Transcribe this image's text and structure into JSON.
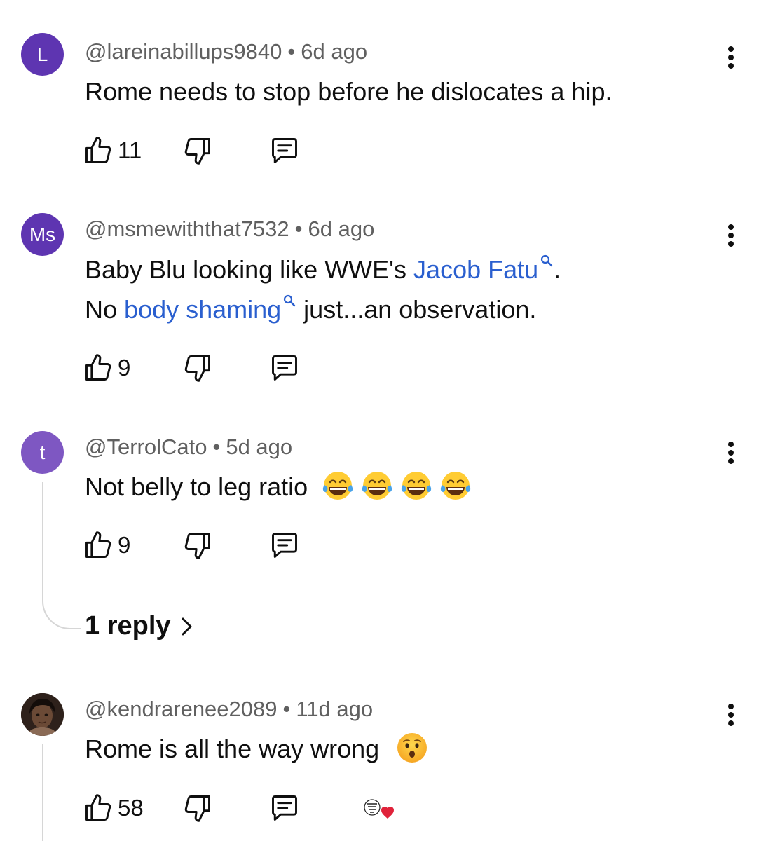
{
  "comments": [
    {
      "avatar_letter": "L",
      "avatar_color": "#5e35b1",
      "username": "@lareinabillups9840",
      "time": "6d ago",
      "text": "Rome needs to stop before he dislocates a hip.",
      "likes": "11"
    },
    {
      "avatar_letter": "Ms",
      "avatar_color": "#5e35b1",
      "username": "@msmewiththat7532",
      "time": "6d ago",
      "text_parts": {
        "line1_a": "Baby Blu looking like WWE's ",
        "line1_link": "Jacob Fatu",
        "line1_b": ".",
        "line2_a": "No ",
        "line2_link": "body shaming",
        "line2_b": " just...an observation."
      },
      "likes": "9"
    },
    {
      "avatar_letter": "t",
      "avatar_color": "#7e57c2",
      "username": "@TerrolCato",
      "time": "5d ago",
      "text": "Not belly to leg ratio",
      "emoji_count": 4,
      "emoji_name": "face-with-tears-of-joy",
      "likes": "9",
      "replies_label": "1 reply"
    },
    {
      "avatar_image": "profile-photo",
      "username": "@kendrarenee2089",
      "time": "11d ago",
      "text": "Rome is all the way wrong",
      "emoji_name": "hushed-face",
      "likes": "58",
      "creator_heart": "creator-heart-badge"
    }
  ],
  "separator": "•",
  "colors": {
    "link": "#2a5fcf",
    "meta": "#606060",
    "heart": "#e0223a"
  }
}
